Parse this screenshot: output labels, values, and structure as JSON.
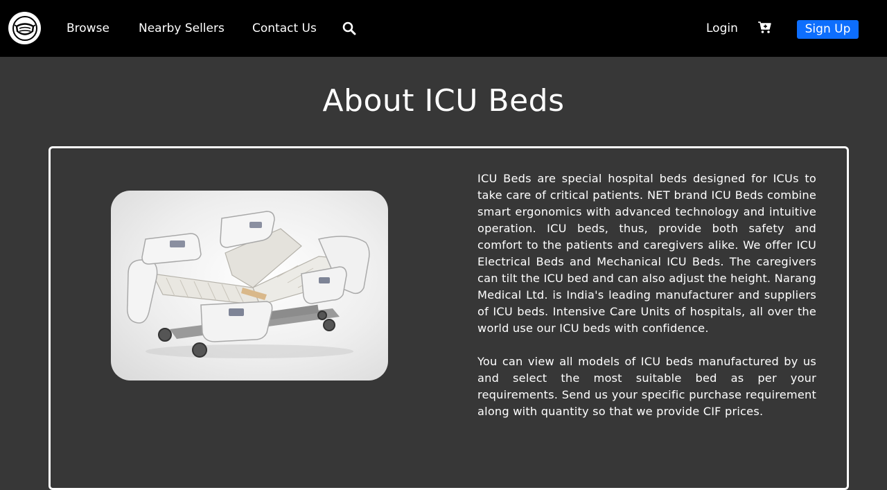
{
  "navbar": {
    "links": [
      "Browse",
      "Nearby Sellers",
      "Contact Us"
    ],
    "login": "Login",
    "signup": "Sign Up",
    "logo_icon": "face-mask-icon",
    "search_icon": "search-icon",
    "cart_icon": "cart-plus-icon"
  },
  "page": {
    "title": "About ICU Beds"
  },
  "content": {
    "paragraphs": [
      "ICU Beds are special hospital beds designed for ICUs to take care of critical patients. NET brand ICU Beds combine smart ergonomics with advanced technology and intuitive operation. ICU beds, thus, provide both safety and comfort to the patients and caregivers alike. We offer ICU Electrical Beds and Mechanical ICU Beds. The caregivers can tilt the ICU bed and can also adjust the height. Narang Medical Ltd. is India's leading manufacturer and suppliers of ICU beds. Intensive Care Units of hospitals, all over the world use our ICU beds with confidence.",
      "You can view all models of ICU beds manufactured by us and select the most suitable bed as per your requirements. Send us your specific purchase requirement along with quantity so that we provide CIF prices."
    ]
  },
  "colors": {
    "background": "#373737",
    "navbar": "#000000",
    "accent": "#0d6efd",
    "text": "#ffffff"
  }
}
